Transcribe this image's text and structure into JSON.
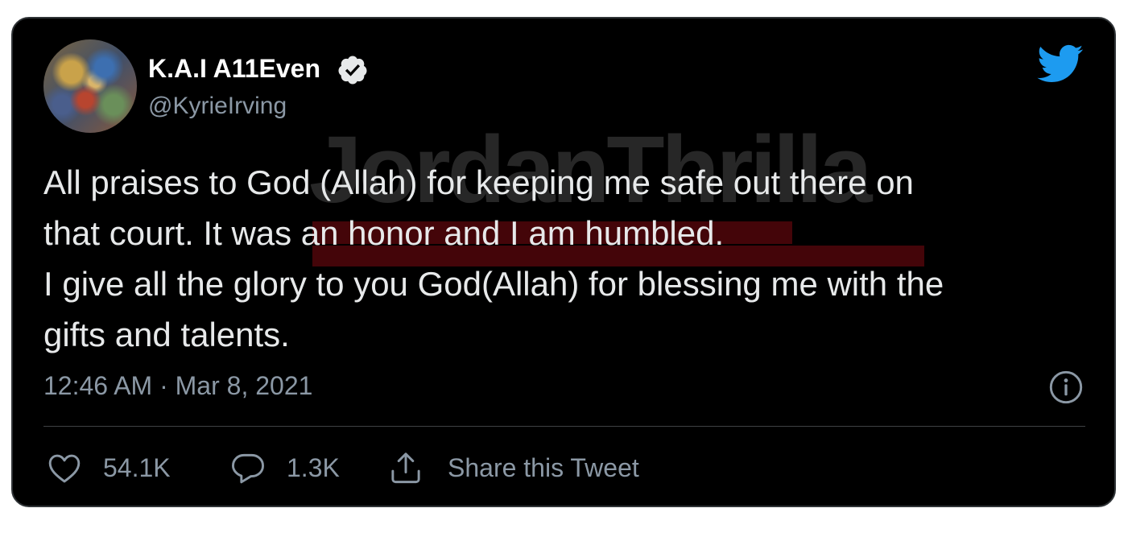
{
  "author": {
    "display_name": "K.A.I A11Even",
    "handle": "@KyrieIrving",
    "verified": true,
    "avatar_icon": "avatar"
  },
  "brand": {
    "logo_icon": "twitter-bird-icon",
    "logo_color": "#1d9bf0"
  },
  "watermark": {
    "text": "JordanThrilla",
    "bar_color": "#960a14"
  },
  "tweet": {
    "text": "All praises to God (Allah) for keeping me safe out there on\nthat court. It was an honor and I am humbled.\nI give all the glory to you God(Allah) for blessing me with the\ngifts and talents.",
    "timestamp": "12:46 AM · Mar 8, 2021"
  },
  "actions": {
    "likes": "54.1K",
    "replies": "1.3K",
    "share_label": "Share this Tweet"
  },
  "colors": {
    "background": "#000000",
    "text_primary": "#e7e9ea",
    "text_secondary": "#8b98a5",
    "border": "#2f3336"
  }
}
